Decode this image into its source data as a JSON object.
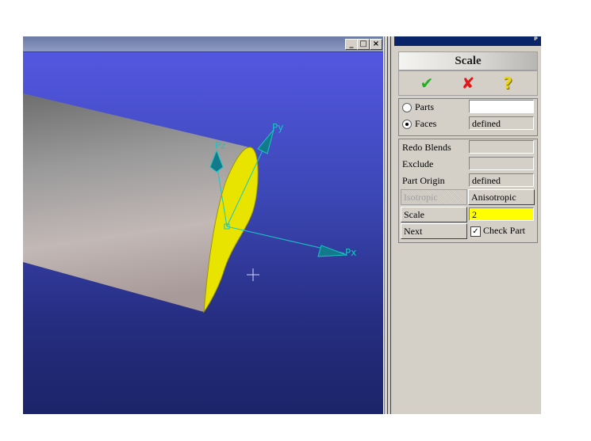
{
  "window_controls": {
    "minimize": "_",
    "maximize": "□",
    "close": "×"
  },
  "viewport": {
    "axis_labels": {
      "px": "Px",
      "py": "Py",
      "pz": "Pz"
    },
    "colors": {
      "axis": "#19c5c5",
      "face": "#e8e400",
      "background_top": "#5357e0",
      "background_bottom": "#1c2468"
    }
  },
  "panel": {
    "pin": "ᵖ",
    "title": "Scale",
    "actions": {
      "ok_icon": "checkmark-icon",
      "cancel_icon": "x-icon",
      "help_icon": "help-icon",
      "ok": "✔",
      "cancel": "✘",
      "help": "?"
    },
    "target": {
      "parts_label": "Parts",
      "parts_value": "",
      "faces_label": "Faces",
      "faces_value": "defined",
      "selected": "Faces"
    },
    "options": {
      "redo_blends_label": "Redo Blends",
      "redo_blends_value": "",
      "exclude_label": "Exclude",
      "exclude_value": "",
      "part_origin_label": "Part Origin",
      "part_origin_value": "defined",
      "isotropic_label": "Isotropic",
      "anisotropic_label": "Anisotropic",
      "scale_label": "Scale",
      "scale_value": "2",
      "next_label": "Next",
      "check_part_label": "Check Part",
      "check_part_checked": true
    }
  }
}
